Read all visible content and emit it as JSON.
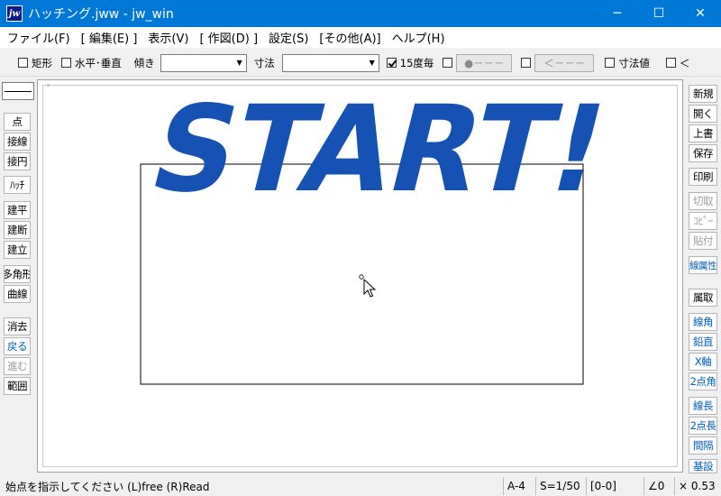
{
  "window": {
    "title": "ハッチング.jww - jw_win",
    "app_icon_label": "jw",
    "minimize": "─",
    "maximize": "☐",
    "close": "✕"
  },
  "menu": [
    "ファイル(F)",
    "[ 編集(E) ]",
    "表示(V)",
    "[ 作図(D) ]",
    "設定(S)",
    "[その他(A)]",
    "ヘルプ(H)"
  ],
  "toolbar": {
    "rect_label": "矩形",
    "hv_label": "水平･垂直",
    "tilt_label": "傾き",
    "size_label": "寸法",
    "deg15_label": "15度毎",
    "circle_btn": "●－－－",
    "arrow_btn": "＜－－－",
    "dimval_label": "寸法値",
    "lt_label": "＜"
  },
  "left_palette": [
    "点",
    "接線",
    "接円",
    "ﾊｯﾁ",
    "建平",
    "建断",
    "建立",
    "多角形",
    "曲線",
    "消去",
    "戻る",
    "進む",
    "範囲"
  ],
  "right_palette": [
    "新規",
    "開く",
    "上書",
    "保存",
    "印刷",
    "切取",
    "ｺﾋﾟｰ",
    "貼付",
    "線属性",
    "属取",
    "線角",
    "鉛直",
    "X軸",
    "2点角",
    "線長",
    "2点長",
    "間隔",
    "基設"
  ],
  "canvas": {
    "overlay_text": "START!",
    "overlay_color": "#1652b4"
  },
  "status": {
    "message": "始点を指示してください (L)free (R)Read",
    "paper": "A-4",
    "scale": "S=1/50",
    "layer": "[0-0]",
    "angle": "∠0",
    "zoom": "× 0.53"
  }
}
